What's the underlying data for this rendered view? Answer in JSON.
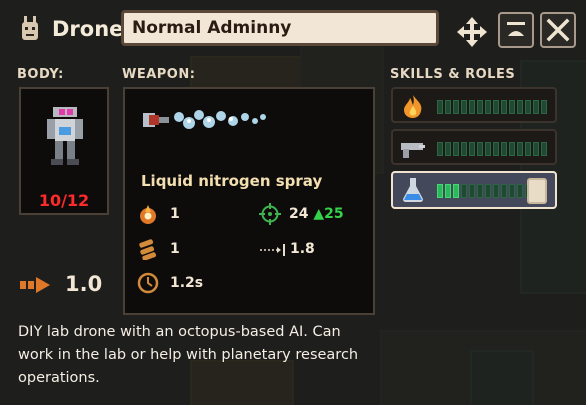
{
  "header": {
    "title": "Drone",
    "name_value": "Normal Adminny"
  },
  "labels": {
    "body": "BODY:",
    "weapon": "WEAPON:",
    "skills": "SKILLS & ROLES"
  },
  "body": {
    "hp": "10/12"
  },
  "weapon": {
    "name": "Liquid nitrogen spray",
    "stats": {
      "damage": "1",
      "accuracy": "24",
      "accuracy_bonus": "25",
      "ammo": "1",
      "range": "1.8",
      "cooldown": "1.2s"
    }
  },
  "speed": "1.0",
  "skills": [
    {
      "icon": "fire-icon",
      "filled": 0,
      "total": 14
    },
    {
      "icon": "gun-icon",
      "filled": 0,
      "total": 14
    },
    {
      "icon": "flask-icon",
      "filled": 3,
      "total": 14,
      "selected": true
    }
  ],
  "description": "DIY lab drone with an octopus-based AI. Can work in the lab or help with planetary research operations.",
  "colors": {
    "hp": "#ff2a2a",
    "skill_bar_on": "#29b85a",
    "accent_orange": "#e0782a"
  }
}
